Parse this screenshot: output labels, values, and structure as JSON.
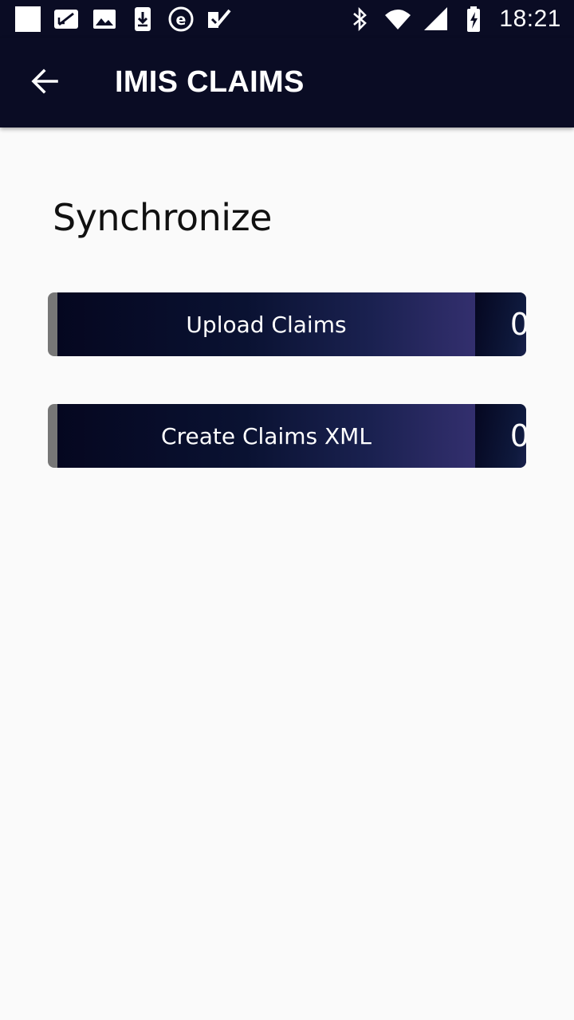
{
  "status_bar": {
    "time": "18:21",
    "left_icons": [
      "square-notification-icon",
      "screen-rotate-icon",
      "image-icon",
      "download-icon",
      "e-app-icon",
      "task-check-icon"
    ],
    "right_icons": [
      "bluetooth-icon",
      "wifi-icon",
      "signal-icon",
      "battery-charging-icon"
    ]
  },
  "app_bar": {
    "title": "IMIS CLAIMS",
    "back_icon": "arrow-back-icon"
  },
  "main": {
    "section_title": "Synchronize",
    "actions": [
      {
        "label": "Upload Claims",
        "count": "0"
      },
      {
        "label": "Create Claims XML",
        "count": "0"
      }
    ]
  },
  "colors": {
    "toolbar": "#0a0c24",
    "background": "#fafafa",
    "button_border": "#777777"
  }
}
